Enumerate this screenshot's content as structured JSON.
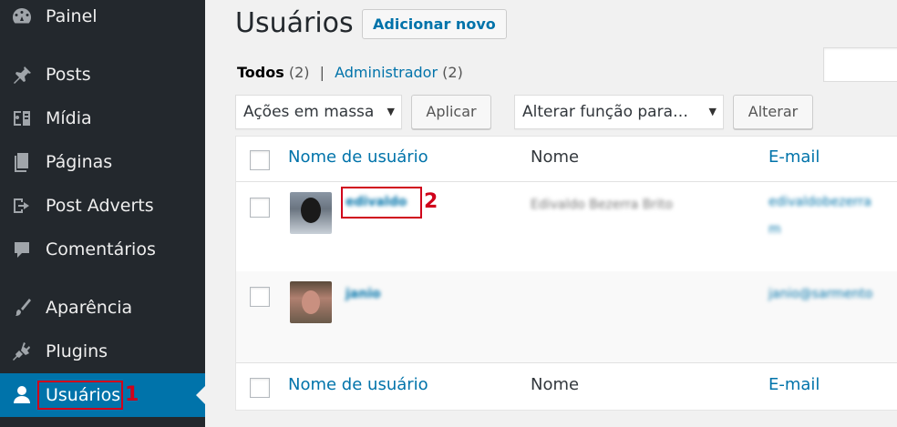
{
  "sidebar": {
    "items": [
      {
        "label": "Painel",
        "icon": "dashboard-icon"
      },
      {
        "label": "Posts",
        "icon": "pin-icon"
      },
      {
        "label": "Mídia",
        "icon": "media-icon"
      },
      {
        "label": "Páginas",
        "icon": "pages-icon"
      },
      {
        "label": "Post Adverts",
        "icon": "adverts-icon"
      },
      {
        "label": "Comentários",
        "icon": "comment-icon"
      },
      {
        "label": "Aparência",
        "icon": "brush-icon"
      },
      {
        "label": "Plugins",
        "icon": "plugin-icon"
      },
      {
        "label": "Usuários",
        "icon": "user-icon",
        "active": true
      }
    ],
    "annotation": "1"
  },
  "header": {
    "title": "Usuários",
    "add_new_label": "Adicionar novo"
  },
  "filters": {
    "all_label": "Todos",
    "all_count": "(2)",
    "separator": "|",
    "admin_label": "Administrador",
    "admin_count": "(2)"
  },
  "actions": {
    "bulk_select": "Ações em massa",
    "apply_label": "Aplicar",
    "role_select": "Alterar função para…",
    "change_label": "Alterar"
  },
  "table": {
    "columns": [
      "Nome de usuário",
      "Nome",
      "E-mail"
    ],
    "rows": [
      {
        "username": "edivaldo",
        "name": "Edivaldo Bezerra Brito",
        "email": "edivaldobezerra",
        "email2": "m"
      },
      {
        "username": "janio",
        "name": "",
        "email": "janio@sarmento"
      }
    ],
    "annotation": "2"
  },
  "colors": {
    "sidebar_bg": "#23282d",
    "active_bg": "#0073aa",
    "link": "#0073aa",
    "annotation": "#d0021b"
  }
}
